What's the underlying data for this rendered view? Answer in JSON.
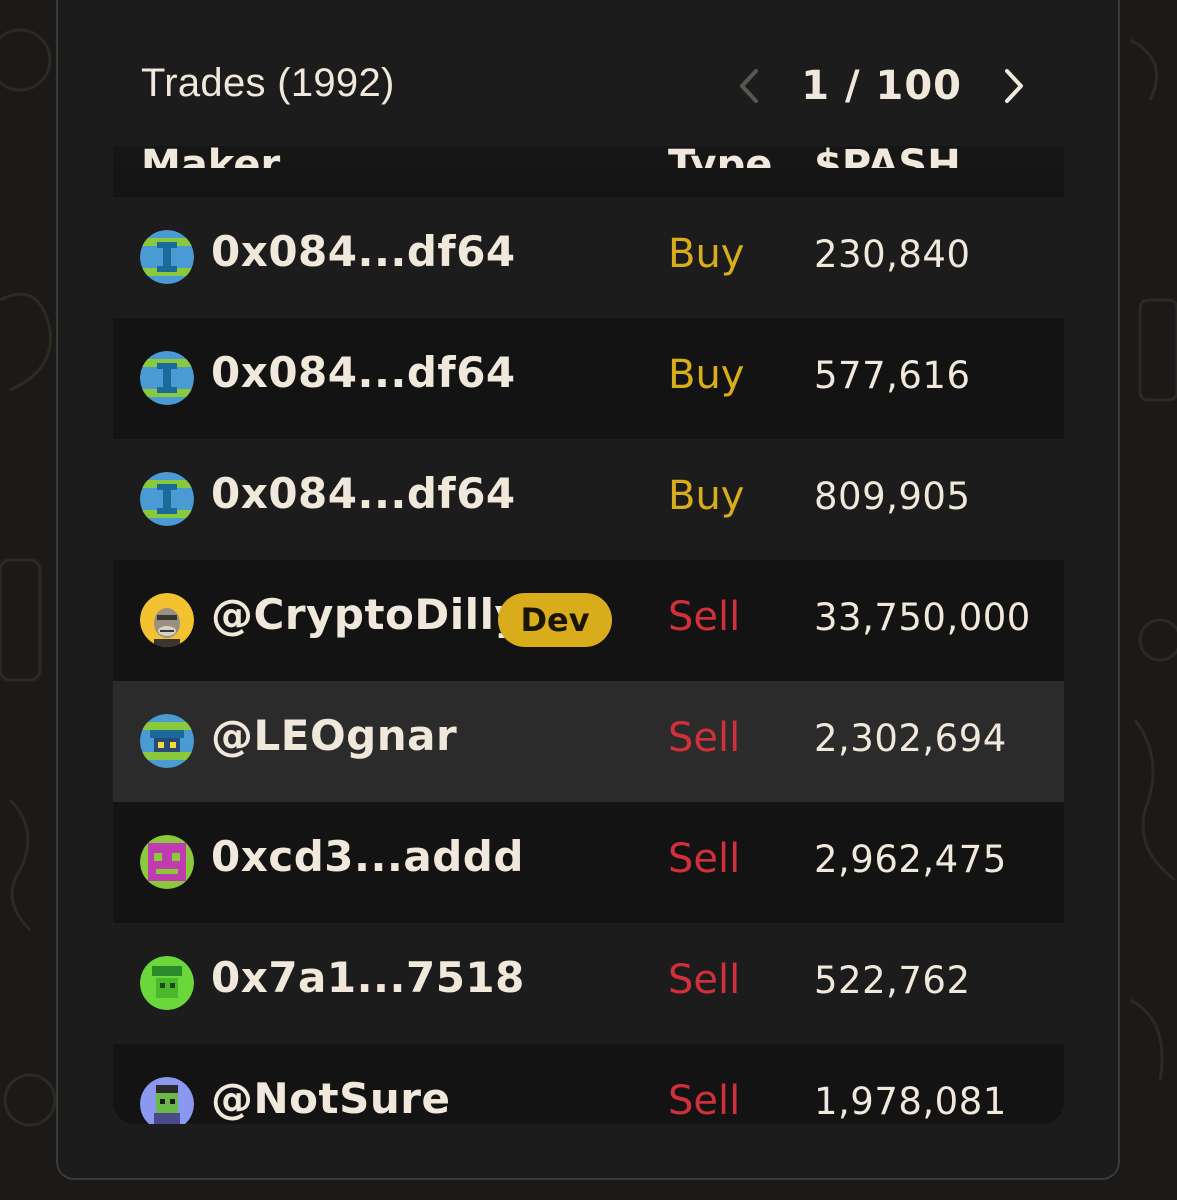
{
  "header": {
    "title": "Trades (1992)",
    "page_indicator": "1 / 100"
  },
  "columns": {
    "maker": "Maker",
    "type": "Type",
    "amount": "$PASH"
  },
  "colors": {
    "buy": "#d8ac1a",
    "sell": "#d0303a",
    "badge": "#d8ac1a",
    "panel": "#141414"
  },
  "trades": [
    {
      "maker": "0x084...df64",
      "type": "Buy",
      "amount": "230,840",
      "avatar": "pixel-globe-avatar"
    },
    {
      "maker": "0x084...df64",
      "type": "Buy",
      "amount": "577,616",
      "avatar": "pixel-globe-avatar"
    },
    {
      "maker": "0x084...df64",
      "type": "Buy",
      "amount": "809,905",
      "avatar": "pixel-globe-avatar"
    },
    {
      "maker": "@CryptoDilly",
      "badge": "Dev",
      "type": "Sell",
      "amount": "33,750,000",
      "avatar": "ape-avatar"
    },
    {
      "maker": "@LEOgnar",
      "type": "Sell",
      "amount": "2,302,694",
      "avatar": "pixel-globe-avatar"
    },
    {
      "maker": "0xcd3...addd",
      "type": "Sell",
      "amount": "2,962,475",
      "avatar": "pixel-face-avatar"
    },
    {
      "maker": "0x7a1...7518",
      "type": "Sell",
      "amount": "522,762",
      "avatar": "pixel-green-avatar"
    },
    {
      "maker": "@NotSure",
      "type": "Sell",
      "amount": "1,978,081",
      "avatar": "pixel-character-avatar"
    }
  ]
}
